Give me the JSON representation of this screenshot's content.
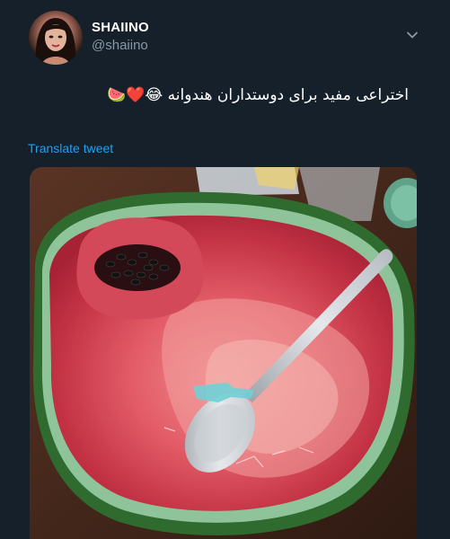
{
  "author": {
    "display_name": "SHAIINO",
    "handle": "@shaiino"
  },
  "tweet": {
    "text": "اختراعی مفید برای دوستداران هندوانه 😂❤️🍉",
    "translate_label": "Translate tweet"
  },
  "icons": {
    "menu": "chevron-down-icon"
  },
  "colors": {
    "background": "#15202b",
    "name": "#ffffff",
    "handle": "#8899a6",
    "link": "#1da1f2"
  }
}
